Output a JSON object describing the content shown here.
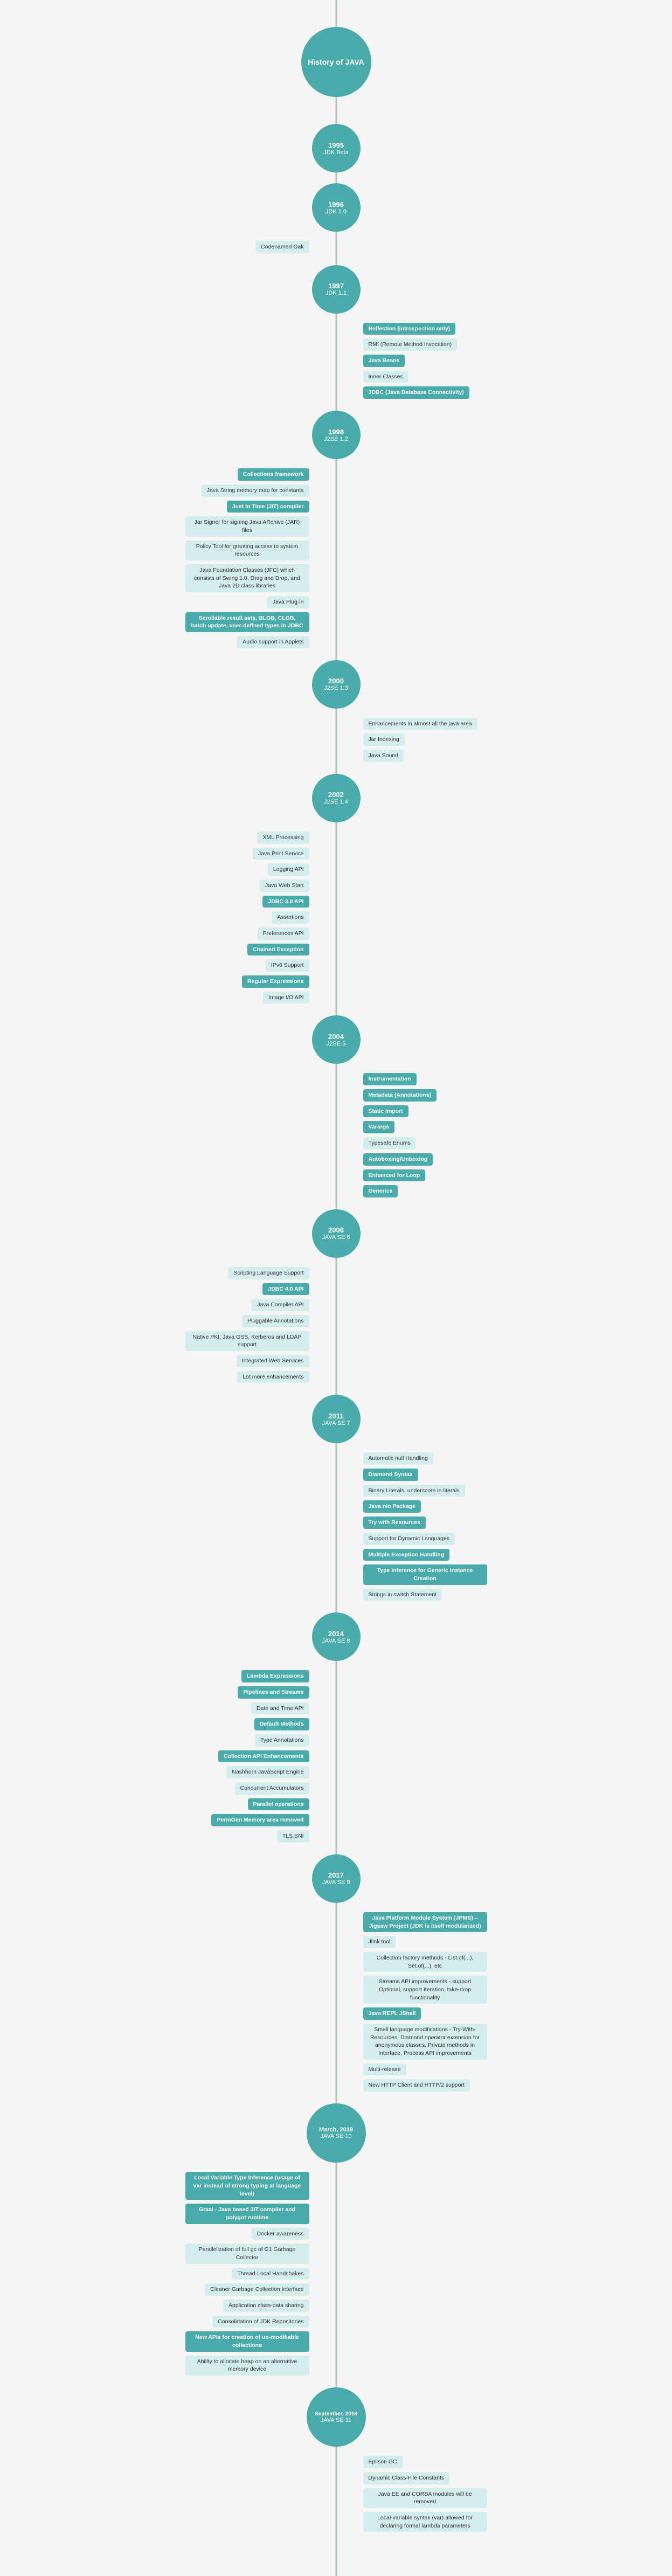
{
  "title": "History of JAVA",
  "eras": [
    {
      "id": "jdk-beta",
      "year": "1995",
      "name": "JDK Beta",
      "side": "right",
      "features": []
    },
    {
      "id": "jdk-1-0",
      "year": "1996",
      "name": "JDK 1.0",
      "side": "right",
      "features": [
        {
          "text": "Codenamed Oak",
          "style": "teal-light",
          "side": "left"
        }
      ]
    },
    {
      "id": "jdk-1-1",
      "year": "1997",
      "name": "JDK 1.1",
      "side": "right",
      "features": [
        {
          "text": "Reflection (introspection only)",
          "style": "teal-filled",
          "side": "right"
        },
        {
          "text": "RMI (Remote Method Invocation)",
          "style": "teal-light",
          "side": "right"
        },
        {
          "text": "Java Beans",
          "style": "teal-filled",
          "side": "right"
        },
        {
          "text": "Inner Classes",
          "style": "teal-light",
          "side": "right"
        },
        {
          "text": "JDBC (Java Database Connectivity)",
          "style": "teal-filled",
          "side": "right"
        }
      ]
    },
    {
      "id": "j2se-1-2",
      "year": "1998",
      "name": "J2SE 1.2",
      "side": "right",
      "features_left": [
        {
          "text": "Collections framework",
          "style": "teal-filled"
        },
        {
          "text": "Java String memory map for constants",
          "style": "teal-light"
        },
        {
          "text": "Just In Time (JIT) compiler",
          "style": "teal-filled"
        },
        {
          "text": "Jar Signer for signing Java ARchive (JAR) files",
          "style": "teal-light"
        },
        {
          "text": "Policy Tool for granting access to system resources",
          "style": "teal-light"
        },
        {
          "text": "Java Foundation Classes (JFC) which consists of Swing 1.0, Drag and Drop, and Java 2D class libraries",
          "style": "teal-light"
        },
        {
          "text": "Java Plug-in",
          "style": "teal-light"
        },
        {
          "text": "Scrollable result sets, BLOB, CLOB, batch update, user-defined types in JDBC",
          "style": "teal-filled"
        },
        {
          "text": "Audio support in Applets",
          "style": "teal-light"
        }
      ]
    },
    {
      "id": "j2se-1-3",
      "year": "2000",
      "name": "J2SE 1.3",
      "side": "right",
      "features_right": [
        {
          "text": "Enhancements in almost all the java area",
          "style": "teal-light"
        },
        {
          "text": "Jar Indexing",
          "style": "teal-light"
        },
        {
          "text": "Java Sound",
          "style": "teal-light"
        }
      ]
    },
    {
      "id": "j2se-1-4",
      "year": "2002",
      "name": "J2SE 1.4",
      "side": "right",
      "features_left": [
        {
          "text": "XML Processing",
          "style": "teal-light"
        },
        {
          "text": "Java Print Service",
          "style": "teal-light"
        },
        {
          "text": "Logging API",
          "style": "teal-light"
        },
        {
          "text": "Java Web Start",
          "style": "teal-light"
        },
        {
          "text": "JDBC 3.0 API",
          "style": "teal-filled"
        },
        {
          "text": "Assertions",
          "style": "teal-light"
        },
        {
          "text": "Preferences API",
          "style": "teal-light"
        },
        {
          "text": "Chained Exception",
          "style": "teal-filled"
        },
        {
          "text": "IPv6 Support",
          "style": "teal-light"
        },
        {
          "text": "Regular Expressions",
          "style": "teal-filled"
        },
        {
          "text": "Image I/O API",
          "style": "teal-light"
        }
      ]
    },
    {
      "id": "j2se-5",
      "year": "2004",
      "name": "J2SE 5",
      "side": "right",
      "features_right": [
        {
          "text": "Instrumentation",
          "style": "teal-filled"
        },
        {
          "text": "Metadata (Annotations)",
          "style": "teal-filled"
        },
        {
          "text": "Static Import",
          "style": "teal-filled"
        },
        {
          "text": "Varargs",
          "style": "teal-filled"
        },
        {
          "text": "Typesafe Enums",
          "style": "teal-light"
        },
        {
          "text": "Autoboxing/Unboxing",
          "style": "teal-filled"
        },
        {
          "text": "Enhanced for Loop",
          "style": "teal-filled"
        },
        {
          "text": "Generics",
          "style": "teal-filled"
        }
      ]
    },
    {
      "id": "java-se-6",
      "year": "2006",
      "name": "JAVA SE 6",
      "side": "right",
      "features_left": [
        {
          "text": "Scripting Language Support",
          "style": "teal-light"
        },
        {
          "text": "JDBC 4.0 API",
          "style": "teal-filled"
        },
        {
          "text": "Java Compiler API",
          "style": "teal-light"
        },
        {
          "text": "Pluggable Annotations",
          "style": "teal-light"
        },
        {
          "text": "Native PKI, Java GSS, Kerberos and LDAP support",
          "style": "teal-light"
        },
        {
          "text": "Integrated Web Services",
          "style": "teal-light"
        },
        {
          "text": "Lot more enhancements",
          "style": "teal-light"
        }
      ]
    },
    {
      "id": "java-se-7",
      "year": "2011",
      "name": "JAVA SE 7",
      "side": "right",
      "features_right": [
        {
          "text": "Automatic null Handling",
          "style": "teal-light"
        },
        {
          "text": "Diamond Syntax",
          "style": "teal-filled"
        },
        {
          "text": "Binary Literals, underscore in literals",
          "style": "teal-light"
        },
        {
          "text": "Java nio Package",
          "style": "teal-filled"
        },
        {
          "text": "Try with Resources",
          "style": "teal-filled"
        },
        {
          "text": "Support for Dynamic Languages",
          "style": "teal-light"
        },
        {
          "text": "Multiple Exception Handling",
          "style": "teal-filled"
        },
        {
          "text": "Type Inference for Generic Instance Creation",
          "style": "teal-filled"
        },
        {
          "text": "Strings in switch Statement",
          "style": "teal-light"
        }
      ]
    },
    {
      "id": "java-se-8",
      "year": "2014",
      "name": "JAVA SE 8",
      "side": "right",
      "features_left": [
        {
          "text": "Lambda Expressions",
          "style": "teal-filled"
        },
        {
          "text": "Pipelines and Streams",
          "style": "teal-filled"
        },
        {
          "text": "Date and Time API",
          "style": "teal-light"
        },
        {
          "text": "Default Methods",
          "style": "teal-filled"
        },
        {
          "text": "Type Annotations",
          "style": "teal-light"
        },
        {
          "text": "Collection API Enhancements",
          "style": "teal-filled"
        },
        {
          "text": "Nashhorn JavaScript Engine",
          "style": "teal-light"
        },
        {
          "text": "Concurrent Accumulators",
          "style": "teal-light"
        },
        {
          "text": "Parallel operations",
          "style": "teal-filled"
        },
        {
          "text": "PermGen Memory area removed",
          "style": "teal-filled"
        },
        {
          "text": "TLS SNI",
          "style": "teal-light"
        }
      ]
    },
    {
      "id": "java-se-9",
      "year": "2017",
      "name": "JAVA SE 9",
      "side": "right",
      "features_right": [
        {
          "text": "Java Platform Module System (JPMS) – Jigsaw Project (JDK is itself modularized)",
          "style": "teal-filled"
        },
        {
          "text": "Jlink tool",
          "style": "teal-light"
        },
        {
          "text": "Collection factory methods - List.of(...), Set.of(...), etc",
          "style": "teal-light"
        },
        {
          "text": "Streams API improvements - support Optional, support Iteration, take-drop functionality",
          "style": "teal-light"
        },
        {
          "text": "Java REPL JShell",
          "style": "teal-filled"
        },
        {
          "text": "Small language modifications - Try-With-Resources, Diamond operator extension for anonymous classes, Private methods in Interface, Process API improvements",
          "style": "teal-light"
        },
        {
          "text": "Multi-release",
          "style": "teal-light"
        },
        {
          "text": "New HTTP Client and HTTP/2 support",
          "style": "teal-light"
        }
      ]
    },
    {
      "id": "java-se-10",
      "year": "March, 2018",
      "name": "JAVA SE 10",
      "side": "right",
      "features_left": [
        {
          "text": "Local Variable Type Inference (usage of var instead of strong typing at language level)",
          "style": "teal-filled"
        },
        {
          "text": "Graal - Java based JIT compiler and polygot runtime",
          "style": "teal-filled"
        },
        {
          "text": "Docker awareness",
          "style": "teal-light"
        },
        {
          "text": "Parallelization of full gc of G1 Garbage Collector",
          "style": "teal-light"
        },
        {
          "text": "Thread-Local Handshakes",
          "style": "teal-light"
        },
        {
          "text": "Cleaner Garbage Collection Interface",
          "style": "teal-light"
        },
        {
          "text": "Application class-data sharing",
          "style": "teal-light"
        },
        {
          "text": "Consolidation of JDK Repositories",
          "style": "teal-light"
        },
        {
          "text": "New APIs for creation of un-modifiable collections",
          "style": "teal-filled"
        },
        {
          "text": "Ability to allocate heap on an alternative memory device",
          "style": "teal-light"
        }
      ]
    },
    {
      "id": "java-se-11",
      "year": "September, 2018",
      "name": "JAVA SE 11",
      "side": "right",
      "features_right": [
        {
          "text": "Eplison GC",
          "style": "teal-light"
        },
        {
          "text": "Dynamic Class-File Constants",
          "style": "teal-light"
        },
        {
          "text": "Java EE and CORBA modules will be removed",
          "style": "teal-light"
        },
        {
          "text": "Local-variable syntax (var) allowed for declaring formal lambda parameters",
          "style": "teal-light"
        }
      ]
    }
  ]
}
